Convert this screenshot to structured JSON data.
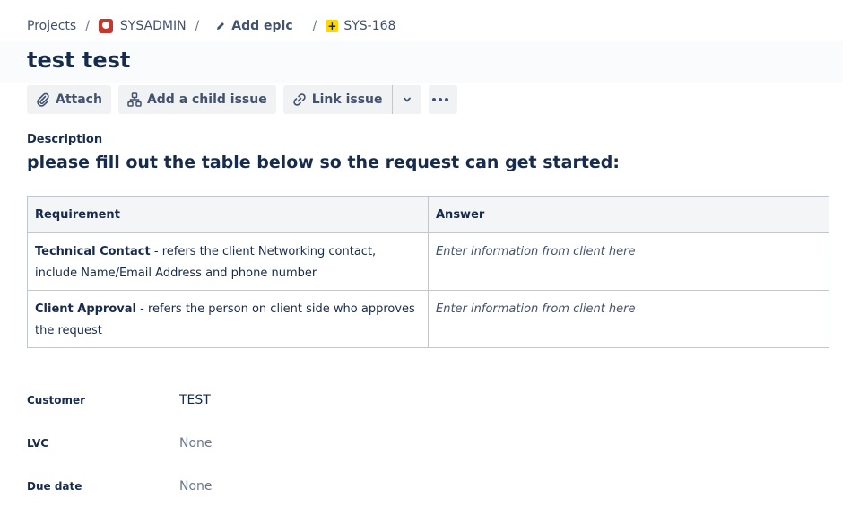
{
  "breadcrumb": {
    "projects": "Projects",
    "separator": "/",
    "project": "SYSADMIN",
    "epic": "Add epic",
    "issue_key": "SYS-168",
    "issue_type_glyph": "+"
  },
  "issue": {
    "title": "test test"
  },
  "toolbar": {
    "attach": "Attach",
    "add_child": "Add a child issue",
    "link_issue": "Link issue"
  },
  "description": {
    "label": "Description",
    "heading": "please fill out the table below so the request can get started:",
    "table": {
      "headers": [
        "Requirement",
        "Answer"
      ],
      "rows": [
        {
          "term": "Technical Contact",
          "detail": " - refers the client Networking contact, include Name/Email Address and phone number",
          "answer": "Enter information from client here"
        },
        {
          "term": "Client Approval",
          "detail": " - refers the person on client side who approves the request",
          "answer": "Enter information from client here"
        }
      ]
    }
  },
  "fields": [
    {
      "label": "Customer",
      "value": "TEST"
    },
    {
      "label": "LVC",
      "value": "None"
    },
    {
      "label": "Due date",
      "value": "None"
    }
  ],
  "colors": {
    "project_icon": "#c9372c",
    "issue_type_icon": "#ffd700",
    "text": "#172b4d"
  },
  "icons": [
    "project-avatar-icon",
    "pencil-icon",
    "issue-type-icon",
    "paperclip-icon",
    "child-issue-icon",
    "link-icon",
    "chevron-down-icon",
    "more-icon"
  ]
}
